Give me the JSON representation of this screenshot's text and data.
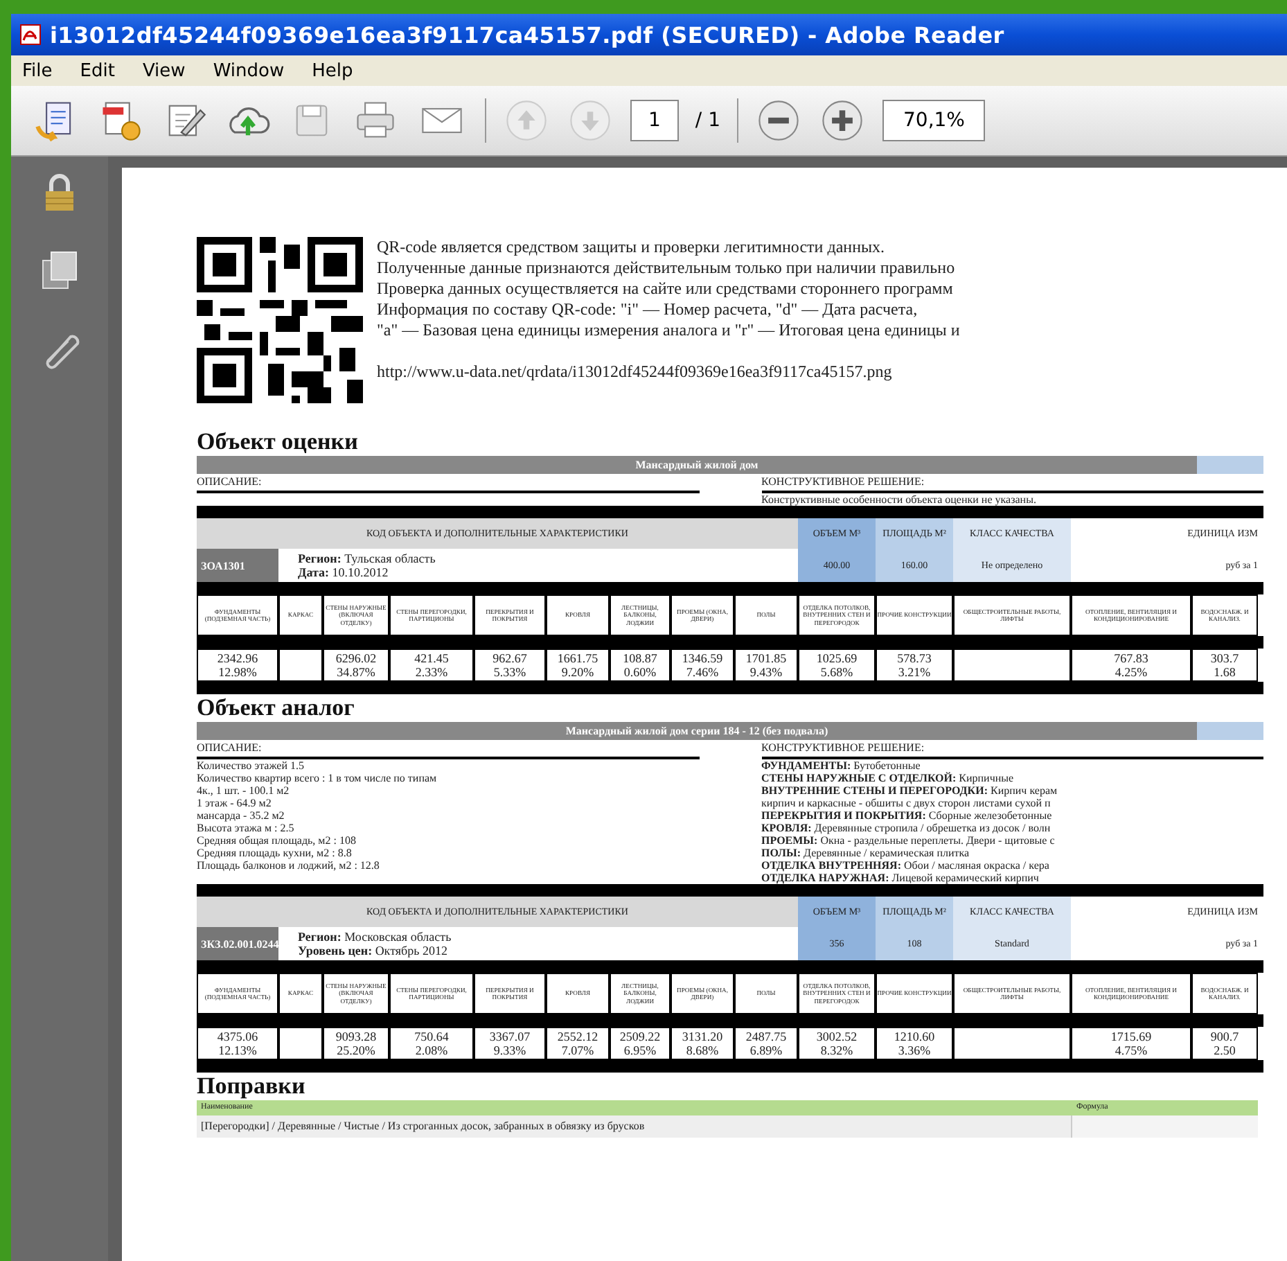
{
  "window": {
    "title": "i13012df45244f09369e16ea3f9117ca45157.pdf (SECURED) - Adobe Reader"
  },
  "menu": [
    {
      "label": "File"
    },
    {
      "label": "Edit"
    },
    {
      "label": "View"
    },
    {
      "label": "Window"
    },
    {
      "label": "Help"
    }
  ],
  "toolbar": {
    "page": "1",
    "page_total": "/ 1",
    "zoom": "70,1%"
  },
  "qr_notice": {
    "lines": [
      "QR-code является средством защиты и проверки легитимности данных.",
      "Полученные данные признаются действительным только при наличии правильно",
      "Проверка данных осуществляется на сайте или средствами стороннего программ",
      "Информация по составу QR-code: \"i\" — Номер расчета, \"d\" — Дата расчета,",
      "\"a\" — Базовая цена единицы измерения аналога и \"r\" — Итоговая цена единицы и"
    ],
    "url": "http://www.u-data.net/qrdata/i13012df45244f09369e16ea3f9117ca45157.png"
  },
  "sections": [
    {
      "heading": "Объект оценки",
      "name_bar": "Мансардный жилой дом",
      "description_label": "ОПИСАНИЕ:",
      "construction_label": "КОНСТРУКТИВНОЕ РЕШЕНИЕ:",
      "construction": [
        "Конструктивные особенности объекта оценки не указаны."
      ],
      "header": [
        "КОД ОБЪЕКТА И ДОПОЛНИТЕЛЬНЫЕ ХАРАКТЕРИСТИКИ",
        "ОБЪЕМ М³",
        "ПЛОЩАДЬ М²",
        "КЛАСС КАЧЕСТВА",
        "ЕДИНИЦА ИЗМ"
      ],
      "code": "ЗОА1301",
      "info": [
        "**Регион:** Тульская область",
        "**Дата:** 10.10.2012"
      ],
      "volume": "400.00",
      "area": "160.00",
      "quality": "Не определено",
      "unit": "руб за 1",
      "element_columns": [
        "ФУНДАМЕНТЫ (ПОДЗЕМНАЯ ЧАСТЬ)",
        "КАРКАС",
        "СТЕНЫ НАРУЖНЫЕ (ВКЛЮЧАЯ ОТДЕЛКУ)",
        "СТЕНЫ ПЕРЕГОРОДКИ, ПАРТИЦИОНЫ",
        "ПЕРЕКРЫТИЯ И ПОКРЫТИЯ",
        "КРОВЛЯ",
        "ЛЕСТНИЦЫ, БАЛКОНЫ, ЛОДЖИИ",
        "ПРОЕМЫ (ОКНА, ДВЕРИ)",
        "ПОЛЫ",
        "ОТДЕЛКА ПОТОЛКОВ, ВНУТРЕННИХ СТЕН И ПЕРЕГОРОДОК",
        "ПРОЧИЕ КОНСТРУКЦИИ",
        "ОБЩЕСТРОИТЕЛЬНЫЕ РАБОТЫ, ЛИФТЫ",
        "ОТОПЛЕНИЕ, ВЕНТИЛЯЦИЯ И КОНДИЦИОНИРОВАНИЕ",
        "ВОДОСНАБЖ. И КАНАЛИЗ."
      ],
      "element_values": [
        {
          "kind": "value",
          "amount": "2342.96",
          "share": "12.98%"
        },
        {
          "kind": "blank"
        },
        {
          "kind": "value",
          "amount": "6296.02",
          "share": "34.87%"
        },
        {
          "kind": "value",
          "amount": "421.45",
          "share": "2.33%"
        },
        {
          "kind": "value",
          "amount": "962.67",
          "share": "5.33%"
        },
        {
          "kind": "value",
          "amount": "1661.75",
          "share": "9.20%"
        },
        {
          "kind": "value",
          "amount": "108.87",
          "share": "0.60%"
        },
        {
          "kind": "value",
          "amount": "1346.59",
          "share": "7.46%"
        },
        {
          "kind": "value",
          "amount": "1701.85",
          "share": "9.43%"
        },
        {
          "kind": "value",
          "amount": "1025.69",
          "share": "5.68%"
        },
        {
          "kind": "value",
          "amount": "578.73",
          "share": "3.21%"
        },
        {
          "kind": "blank"
        },
        {
          "kind": "value",
          "amount": "767.83",
          "share": "4.25%"
        },
        {
          "kind": "value",
          "amount": "303.7",
          "share": "1.68"
        }
      ]
    },
    {
      "heading": "Объект аналог",
      "name_bar": "Мансардный жилой дом серии 184 - 12 (без подвала)",
      "description_label": "ОПИСАНИЕ:",
      "description": [
        "Количество этажей 1.5",
        "Количество квартир всего : 1 в том числе по типам",
        "4к., 1 шт. - 100.1 м2",
        "1 этаж - 64.9 м2",
        "мансарда - 35.2 м2",
        "Высота этажа м : 2.5",
        "Средняя общая площадь, м2 : 108",
        "Средняя площадь кухни, м2 : 8.8",
        "Площадь балконов и лоджий, м2 : 12.8"
      ],
      "construction_label": "КОНСТРУКТИВНОЕ РЕШЕНИЕ:",
      "construction": [
        "**ФУНДАМЕНТЫ:** Бутобетонные",
        "**СТЕНЫ НАРУЖНЫЕ С ОТДЕЛКОЙ:** Кирпичные",
        "**ВНУТРЕННИЕ СТЕНЫ И ПЕРЕГОРОДКИ:** Кирпич керам",
        "кирпич и каркасные - обшиты с двух сторон листами сухой п",
        "**ПЕРЕКРЫТИЯ И ПОКРЫТИЯ:** Сборные железобетонные",
        "**КРОВЛЯ:** Деревянные стропила / обрешетка из досок / волн",
        "**ПРОЕМЫ:** Окна - раздельные переплеты. Двери - щитовые с",
        "**ПОЛЫ:** Деревянные / керамическая плитка",
        "**ОТДЕЛКА ВНУТРЕННЯЯ:** Обои / масляная окраска / кера",
        "**ОТДЕЛКА НАРУЖНАЯ:** Лицевой керамический кирпич"
      ],
      "header": [
        "КОД ОБЪЕКТА И ДОПОЛНИТЕЛЬНЫЕ ХАРАКТЕРИСТИКИ",
        "ОБЪЕМ М³",
        "ПЛОЩАДЬ М²",
        "КЛАСС КАЧЕСТВА",
        "ЕДИНИЦА ИЗМ"
      ],
      "code": "ЗКЗ.02.001.0244",
      "info": [
        "**Регион:** Московская область",
        "**Уровень цен:** Октябрь 2012"
      ],
      "volume": "356",
      "area": "108",
      "quality": "Standard",
      "unit": "руб за 1",
      "element_columns": [
        "ФУНДАМЕНТЫ (ПОДЗЕМНАЯ ЧАСТЬ)",
        "КАРКАС",
        "СТЕНЫ НАРУЖНЫЕ (ВКЛЮЧАЯ ОТДЕЛКУ)",
        "СТЕНЫ ПЕРЕГОРОДКИ, ПАРТИЦИОНЫ",
        "ПЕРЕКРЫТИЯ И ПОКРЫТИЯ",
        "КРОВЛЯ",
        "ЛЕСТНИЦЫ, БАЛКОНЫ, ЛОДЖИИ",
        "ПРОЕМЫ (ОКНА, ДВЕРИ)",
        "ПОЛЫ",
        "ОТДЕЛКА ПОТОЛКОВ, ВНУТРЕННИХ СТЕН И ПЕРЕГОРОДОК",
        "ПРОЧИЕ КОНСТРУКЦИИ",
        "ОБЩЕСТРОИТЕЛЬНЫЕ РАБОТЫ, ЛИФТЫ",
        "ОТОПЛЕНИЕ, ВЕНТИЛЯЦИЯ И КОНДИЦИОНИРОВАНИЕ",
        "ВОДОСНАБЖ. И КАНАЛИЗ."
      ],
      "element_values": [
        {
          "kind": "value",
          "amount": "4375.06",
          "share": "12.13%"
        },
        {
          "kind": "blank"
        },
        {
          "kind": "value",
          "amount": "9093.28",
          "share": "25.20%"
        },
        {
          "kind": "value",
          "amount": "750.64",
          "share": "2.08%"
        },
        {
          "kind": "value",
          "amount": "3367.07",
          "share": "9.33%"
        },
        {
          "kind": "value",
          "amount": "2552.12",
          "share": "7.07%"
        },
        {
          "kind": "value",
          "amount": "2509.22",
          "share": "6.95%"
        },
        {
          "kind": "value",
          "amount": "3131.20",
          "share": "8.68%"
        },
        {
          "kind": "value",
          "amount": "2487.75",
          "share": "6.89%"
        },
        {
          "kind": "value",
          "amount": "3002.52",
          "share": "8.32%"
        },
        {
          "kind": "value",
          "amount": "1210.60",
          "share": "3.36%"
        },
        {
          "kind": "blank"
        },
        {
          "kind": "value",
          "amount": "1715.69",
          "share": "4.75%"
        },
        {
          "kind": "value",
          "amount": "900.7",
          "share": "2.50"
        }
      ]
    }
  ],
  "adjustments": {
    "heading": "Поправки",
    "columns": [
      "Наименование",
      "Формула"
    ],
    "rows": [
      [
        "[Перегородки] / Деревянные / Чистые / Из строганных досок, забранных в обвязку из брусков"
      ]
    ]
  }
}
